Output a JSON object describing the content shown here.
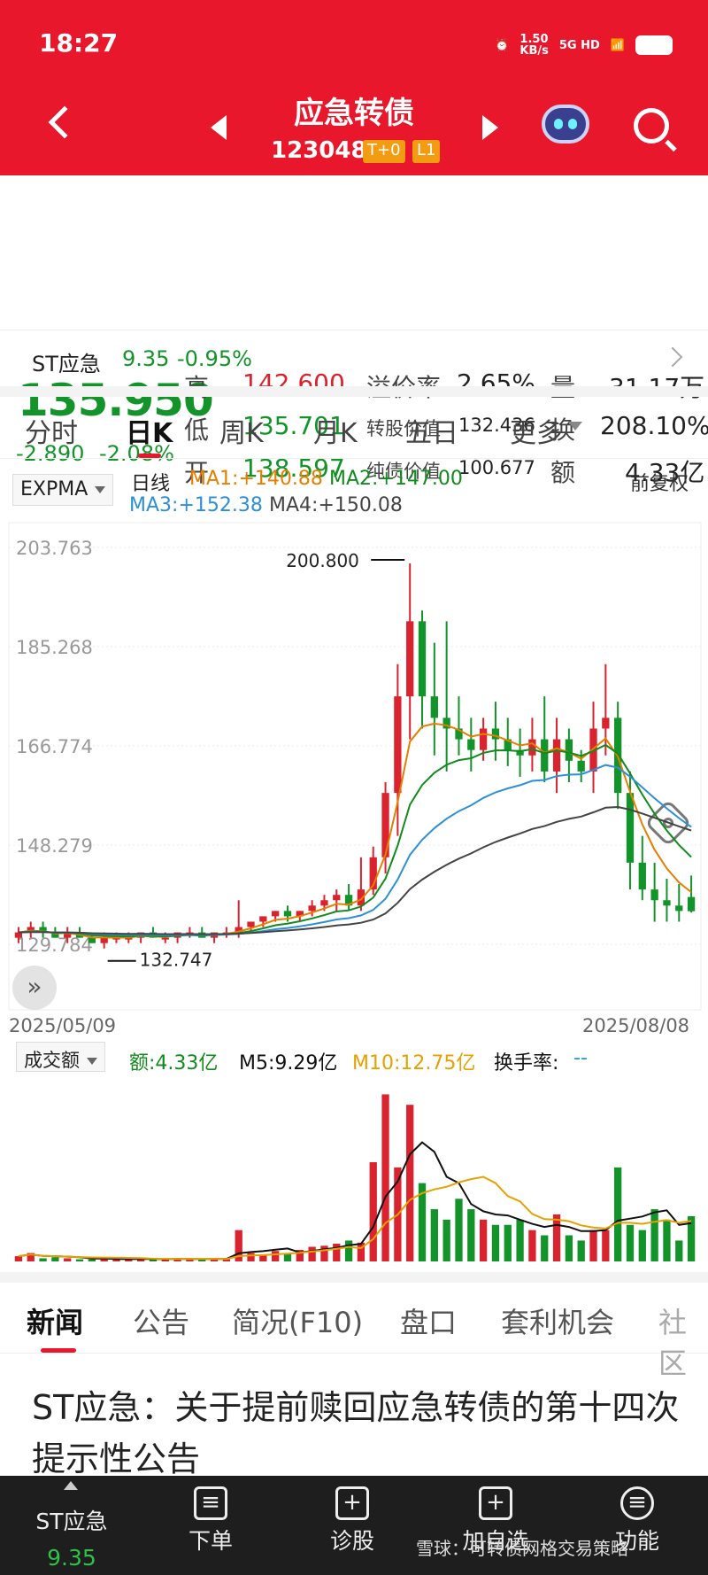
{
  "status": {
    "time": "18:27",
    "net_speed": "1.50\nKB/s",
    "signal": "5G HD"
  },
  "header": {
    "title": "应急转债",
    "code": "123048",
    "tag1": "T+0",
    "tag2": "L1"
  },
  "quote": {
    "price": "135.950",
    "change": "-2.890",
    "change_pct": "-2.08%",
    "high_label": "高",
    "high": "142.600",
    "low_label": "低",
    "low": "135.701",
    "open_label": "开",
    "open": "138.597",
    "premium_label": "溢价率",
    "premium": "2.65%",
    "conv_label": "转股价值",
    "conv": "132.436",
    "bond_label": "纯债价值",
    "bond": "100.677",
    "vol_label": "量",
    "vol": "31.17万",
    "turn_label": "换",
    "turn": "208.10%",
    "amt_label": "额",
    "amt": "4.33亿"
  },
  "stock": {
    "name": "ST应急",
    "price": "9.35",
    "pct": "-0.95%"
  },
  "tabs": [
    "分时",
    "日K",
    "周K",
    "月K",
    "五日",
    "更多"
  ],
  "kchart": {
    "indicator": "EXPMA",
    "line": "日线",
    "ma1": "MA1:+140.88",
    "ma2": "MA2:+147.00",
    "ma3": "MA3:+152.38",
    "ma4": "MA4:+150.08",
    "adjust": "前复权",
    "y_labels": [
      "203.763",
      "185.268",
      "166.774",
      "148.279",
      "129.784"
    ],
    "max_label": "200.800",
    "min_label": "132.747",
    "date_start": "2025/05/09",
    "date_end": "2025/08/08"
  },
  "volchart": {
    "indicator": "成交额",
    "amt": "额:4.33亿",
    "m5": "M5:9.29亿",
    "m10": "M10:12.75亿",
    "turnover": "换手率:",
    "turnover_val": "--"
  },
  "news_tabs": [
    "新闻",
    "公告",
    "简况(F10)",
    "盘口",
    "套利机会",
    "社区"
  ],
  "article": "ST应急：关于提前赎回应急转债的第十四次提示性公告",
  "bottom": {
    "stock_name": "ST应急",
    "stock_price": "9.35",
    "order": "下单",
    "diag": "诊股",
    "add": "加自选",
    "func": "功能"
  },
  "watermark": "雪球：可转债网格交易策略",
  "colors": {
    "brand_red": "#e8172c",
    "up": "#d9232f",
    "down": "#13942b",
    "ma1": "#e67e00",
    "ma2": "#128a1e",
    "ma3": "#2d8fd5",
    "ma4": "#444444"
  },
  "chart_data": [
    {
      "type": "candlestick",
      "title": "日K",
      "x_range": [
        "2025/05/09",
        "2025/08/08"
      ],
      "ylim": [
        129.784,
        203.763
      ],
      "series": [
        {
          "name": "日K",
          "ohlc": [
            [
              131,
              133,
              130,
              132
            ],
            [
              132,
              134,
              131,
              133
            ],
            [
              133,
              134,
              131,
              132
            ],
            [
              132,
              133,
              131,
              131
            ],
            [
              131,
              133,
              130,
              132
            ],
            [
              132,
              133,
              131,
              131
            ],
            [
              131,
              132,
              130,
              130
            ],
            [
              130,
              132,
              129,
              131
            ],
            [
              131,
              132,
              130,
              131
            ],
            [
              131,
              132,
              130,
              131
            ],
            [
              131,
              132,
              130,
              132
            ],
            [
              132,
              133,
              131,
              131
            ],
            [
              131,
              132,
              130,
              131
            ],
            [
              131,
              132,
              130,
              132
            ],
            [
              132,
              133,
              131,
              132
            ],
            [
              132,
              133,
              131,
              131
            ],
            [
              131,
              132,
              130,
              132
            ],
            [
              132,
              133,
              131,
              132
            ],
            [
              132,
              138,
              131,
              133
            ],
            [
              133,
              134,
              132,
              134
            ],
            [
              134,
              135,
              133,
              135
            ],
            [
              135,
              136,
              134,
              136
            ],
            [
              136,
              137,
              134,
              135
            ],
            [
              135,
              136,
              134,
              136
            ],
            [
              136,
              138,
              135,
              137
            ],
            [
              137,
              139,
              136,
              138
            ],
            [
              138,
              140,
              136,
              139
            ],
            [
              139,
              141,
              136,
              137
            ],
            [
              137,
              146,
              136,
              140
            ],
            [
              140,
              148,
              139,
              146
            ],
            [
              146,
              160,
              143,
              158
            ],
            [
              158,
              182,
              150,
              176
            ],
            [
              176,
              200.8,
              168,
              190
            ],
            [
              190,
              192,
              170,
              176
            ],
            [
              176,
              186,
              165,
              172
            ],
            [
              172,
              190,
              162,
              170
            ],
            [
              170,
              176,
              165,
              168
            ],
            [
              168,
              172,
              162,
              166
            ],
            [
              166,
              172,
              164,
              170
            ],
            [
              170,
              175,
              164,
              168
            ],
            [
              168,
              172,
              163,
              166
            ],
            [
              166,
              170,
              161,
              165
            ],
            [
              165,
              172,
              162,
              168
            ],
            [
              168,
              176,
              160,
              162
            ],
            [
              162,
              172,
              158,
              168
            ],
            [
              168,
              170,
              160,
              164
            ],
            [
              164,
              166,
              160,
              162
            ],
            [
              162,
              175,
              158,
              170
            ],
            [
              170,
              182,
              165,
              172
            ],
            [
              172,
              175,
              155,
              158
            ],
            [
              158,
              162,
              140,
              145
            ],
            [
              145,
              150,
              138,
              140
            ],
            [
              140,
              145,
              134,
              138
            ],
            [
              138,
              142,
              134,
              137
            ],
            [
              137,
              141,
              134,
              136
            ],
            [
              138.6,
              142.6,
              135.7,
              135.95
            ]
          ]
        }
      ]
    },
    {
      "type": "bar",
      "title": "成交额",
      "series": [
        {
          "name": "额",
          "values": [
            0.5,
            0.8,
            0.3,
            0.4,
            0.3,
            0.2,
            0.2,
            0.3,
            0.2,
            0.2,
            0.3,
            0.2,
            0.2,
            0.3,
            0.2,
            0.2,
            0.3,
            0.2,
            3.0,
            0.8,
            0.6,
            1.0,
            0.8,
            1.1,
            1.4,
            1.5,
            1.7,
            2.0,
            1.8,
            9.5,
            16.0,
            9.0,
            15.0,
            7.5,
            5.0,
            4.0,
            6.0,
            5.0,
            4.0,
            3.5,
            3.5,
            4.0,
            3.0,
            2.5,
            4.5,
            2.5,
            2.0,
            3.0,
            3.0,
            9.0,
            3.5,
            3.0,
            5.0,
            4.0,
            2.0,
            4.33
          ]
        }
      ]
    }
  ]
}
